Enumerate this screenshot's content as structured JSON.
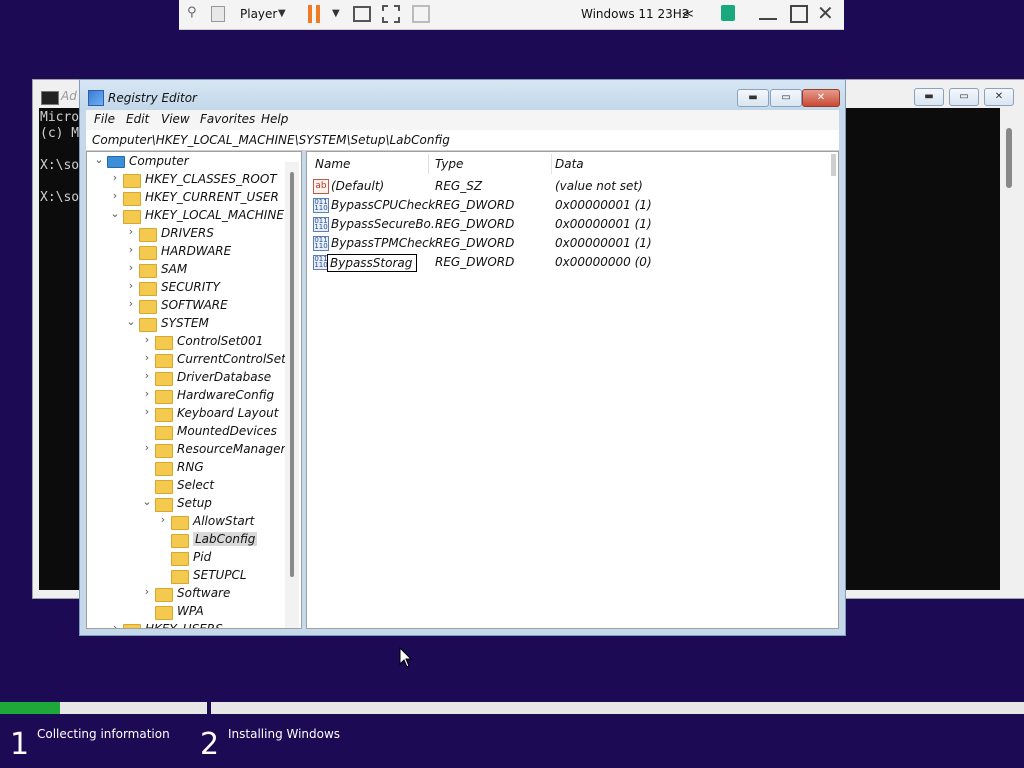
{
  "vm_toolbar": {
    "player_label": "Player",
    "vm_name": "Windows 11 23H2",
    "collapse_label": "≪"
  },
  "console": {
    "title_partial": "Ad",
    "lines": [
      "Micro",
      "(c) M",
      "",
      "X:\\so",
      "",
      "X:\\so"
    ]
  },
  "regedit": {
    "title": "Registry Editor",
    "menu": [
      "File",
      "Edit",
      "View",
      "Favorites",
      "Help"
    ],
    "address": "Computer\\HKEY_LOCAL_MACHINE\\SYSTEM\\Setup\\LabConfig",
    "tree": [
      {
        "label": "Computer",
        "level": 0,
        "chevron": "⌄"
      },
      {
        "label": "HKEY_CLASSES_ROOT",
        "level": 1,
        "chevron": "›"
      },
      {
        "label": "HKEY_CURRENT_USER",
        "level": 1,
        "chevron": "›"
      },
      {
        "label": "HKEY_LOCAL_MACHINE",
        "level": 1,
        "chevron": "⌄"
      },
      {
        "label": "DRIVERS",
        "level": 2,
        "chevron": "›"
      },
      {
        "label": "HARDWARE",
        "level": 2,
        "chevron": "›"
      },
      {
        "label": "SAM",
        "level": 2,
        "chevron": "›"
      },
      {
        "label": "SECURITY",
        "level": 2,
        "chevron": "›"
      },
      {
        "label": "SOFTWARE",
        "level": 2,
        "chevron": "›"
      },
      {
        "label": "SYSTEM",
        "level": 2,
        "chevron": "⌄"
      },
      {
        "label": "ControlSet001",
        "level": 3,
        "chevron": "›"
      },
      {
        "label": "CurrentControlSet",
        "level": 3,
        "chevron": "›"
      },
      {
        "label": "DriverDatabase",
        "level": 3,
        "chevron": "›"
      },
      {
        "label": "HardwareConfig",
        "level": 3,
        "chevron": "›"
      },
      {
        "label": "Keyboard Layout",
        "level": 3,
        "chevron": "›"
      },
      {
        "label": "MountedDevices",
        "level": 3,
        "chevron": ""
      },
      {
        "label": "ResourceManager",
        "level": 3,
        "chevron": "›"
      },
      {
        "label": "RNG",
        "level": 3,
        "chevron": ""
      },
      {
        "label": "Select",
        "level": 3,
        "chevron": ""
      },
      {
        "label": "Setup",
        "level": 3,
        "chevron": "⌄"
      },
      {
        "label": "AllowStart",
        "level": 4,
        "chevron": "›"
      },
      {
        "label": "LabConfig",
        "level": 4,
        "chevron": "",
        "selected": true
      },
      {
        "label": "Pid",
        "level": 4,
        "chevron": ""
      },
      {
        "label": "SETUPCL",
        "level": 4,
        "chevron": ""
      },
      {
        "label": "Software",
        "level": 3,
        "chevron": "›"
      },
      {
        "label": "WPA",
        "level": 3,
        "chevron": ""
      },
      {
        "label": "HKEY_USERS",
        "level": 1,
        "chevron": "›"
      }
    ],
    "columns": [
      "Name",
      "Type",
      "Data"
    ],
    "values": [
      {
        "name": "(Default)",
        "type": "REG_SZ",
        "data": "(value not set)",
        "icon": "ab"
      },
      {
        "name": "BypassCPUCheck",
        "type": "REG_DWORD",
        "data": "0x00000001 (1)",
        "icon": "bin"
      },
      {
        "name": "BypassSecureBo...",
        "type": "REG_DWORD",
        "data": "0x00000001 (1)",
        "icon": "bin"
      },
      {
        "name": "BypassTPMCheck",
        "type": "REG_DWORD",
        "data": "0x00000001 (1)",
        "icon": "bin"
      },
      {
        "name": "BypassStorag",
        "type": "REG_DWORD",
        "data": "0x00000000 (0)",
        "icon": "bin",
        "editing": true
      }
    ]
  },
  "setup": {
    "progress_step1": 0.29,
    "steps": [
      {
        "number": "1",
        "label": "Collecting information"
      },
      {
        "number": "2",
        "label": "Installing Windows"
      }
    ]
  }
}
